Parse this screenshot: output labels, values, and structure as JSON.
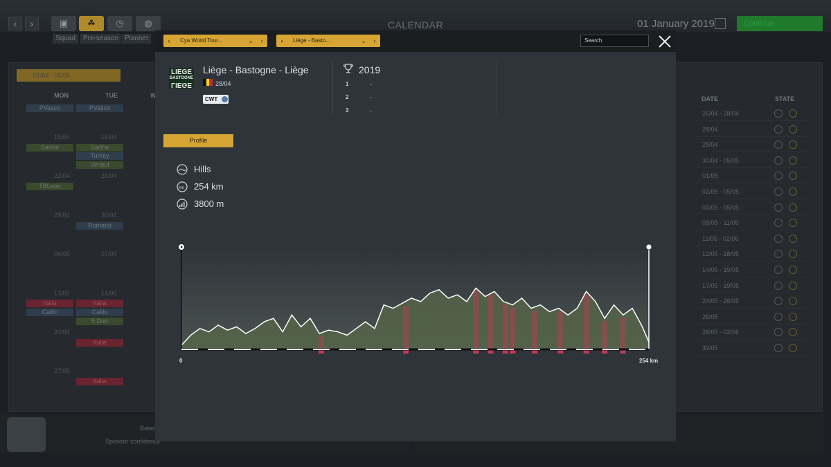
{
  "topbar": {
    "title": "CALENDAR",
    "date": "01 January 2019",
    "continue_label": "Continue",
    "subtabs": [
      "Squad",
      "Pre-season",
      "Planner"
    ]
  },
  "background": {
    "week_selector": "01/04 - 05/05",
    "day_headers": [
      "MON",
      "TUE",
      "W"
    ],
    "right_headers": {
      "date": "DATE",
      "state": "STATE"
    },
    "right_dates": [
      "26/04 - 28/04",
      "28/04",
      "28/04",
      "30/04 - 05/05",
      "01/05",
      "02/05 - 05/05",
      "03/05 - 05/05",
      "09/05 - 11/05",
      "11/05 - 02/06",
      "12/05 - 18/05",
      "14/05 - 19/05",
      "17/05 - 19/05",
      "24/05 - 26/05",
      "26/05",
      "28/05 - 02/06",
      "30/05"
    ],
    "day_numbers": [
      "15/04",
      "16/04",
      "22/04",
      "23/04",
      "29/04",
      "30/04",
      "06/05",
      "07/05",
      "13/05",
      "14/05",
      "20/05",
      "27/05"
    ],
    "chips": [
      "PVasco",
      "PVasco",
      "Sarthe",
      "Sarthe",
      "Turkey",
      "Vimout",
      "TBLeon",
      "Romand",
      "Italia",
      "Italia",
      "Califo",
      "Califo",
      "5 Dun",
      "Italia",
      "Italia"
    ],
    "sponsor_label": "Sponsor confidence",
    "balance_label": "Balan"
  },
  "modal": {
    "dropdown_tour": "Cya World Tour...",
    "dropdown_race": "Liège - Basto...",
    "search_placeholder": "Search",
    "race_name": "Liège - Bastogne - Liège",
    "race_date": "28/04",
    "category": "CWT",
    "logo_text": [
      "LIEGE",
      "BASTOGNE",
      "LIEGE"
    ],
    "year": "2019",
    "podium": [
      {
        "pos": "1",
        "rider": "-"
      },
      {
        "pos": "2",
        "rider": "-"
      },
      {
        "pos": "3",
        "rider": "-"
      }
    ],
    "tab_profile": "Profile",
    "stats": {
      "terrain": "Hills",
      "distance": "254 km",
      "elevation": "3800 m"
    }
  },
  "chart_data": {
    "type": "area",
    "x_start_label": "0",
    "x_end_label": "254 km",
    "x_range": [
      0,
      254
    ],
    "elevation_profile": [
      [
        0,
        2
      ],
      [
        5,
        8
      ],
      [
        10,
        12
      ],
      [
        15,
        10
      ],
      [
        20,
        14
      ],
      [
        25,
        11
      ],
      [
        30,
        13
      ],
      [
        35,
        9
      ],
      [
        40,
        12
      ],
      [
        45,
        16
      ],
      [
        50,
        18
      ],
      [
        55,
        10
      ],
      [
        60,
        20
      ],
      [
        65,
        13
      ],
      [
        70,
        18
      ],
      [
        75,
        9
      ],
      [
        80,
        11
      ],
      [
        85,
        10
      ],
      [
        90,
        8
      ],
      [
        95,
        12
      ],
      [
        100,
        16
      ],
      [
        105,
        12
      ],
      [
        110,
        26
      ],
      [
        115,
        24
      ],
      [
        120,
        27
      ],
      [
        125,
        30
      ],
      [
        130,
        28
      ],
      [
        135,
        33
      ],
      [
        140,
        35
      ],
      [
        145,
        30
      ],
      [
        150,
        32
      ],
      [
        155,
        28
      ],
      [
        160,
        36
      ],
      [
        165,
        31
      ],
      [
        170,
        34
      ],
      [
        175,
        28
      ],
      [
        180,
        26
      ],
      [
        185,
        30
      ],
      [
        190,
        24
      ],
      [
        195,
        26
      ],
      [
        200,
        22
      ],
      [
        205,
        24
      ],
      [
        210,
        20
      ],
      [
        215,
        24
      ],
      [
        220,
        34
      ],
      [
        225,
        28
      ],
      [
        230,
        18
      ],
      [
        235,
        26
      ],
      [
        240,
        20
      ],
      [
        245,
        24
      ],
      [
        250,
        14
      ],
      [
        254,
        4
      ]
    ],
    "climbs_km": [
      76,
      122,
      160,
      168,
      176,
      180,
      192,
      206,
      220,
      230,
      240
    ]
  },
  "colors": {
    "accent": "#d6a534",
    "climb": "#c33a55",
    "line": "#ffffff"
  }
}
